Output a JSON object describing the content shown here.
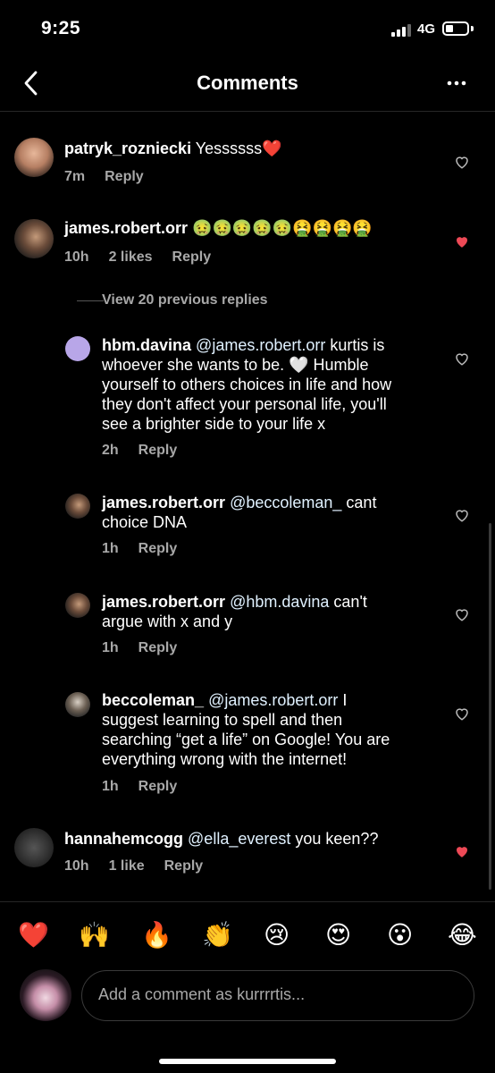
{
  "status": {
    "time": "9:25",
    "network": "4G"
  },
  "header": {
    "title": "Comments"
  },
  "comments": [
    {
      "username": "patryk_rozniecki",
      "text": "Yessssss❤️",
      "time": "7m",
      "likes": "",
      "reply": "Reply",
      "liked": false
    },
    {
      "username": "james.robert.orr",
      "text": "🤢🤢🤢🤢🤢🤮🤮🤮🤮",
      "time": "10h",
      "likes": "2 likes",
      "reply": "Reply",
      "liked": true
    }
  ],
  "view_replies": "View 20 previous replies",
  "replies": [
    {
      "username": "hbm.davina",
      "mention": "@james.robert.orr",
      "text_lines": [
        " kurtis is",
        "whoever she wants to be. 🤍 Humble",
        "yourself to others choices in life and how",
        "they don't affect your personal life, you'll",
        "see a brighter side to your life x"
      ],
      "time": "2h",
      "reply": "Reply"
    },
    {
      "username": "james.robert.orr",
      "mention": "@beccoleman_",
      "text_lines": [
        " cant",
        "choice DNA"
      ],
      "time": "1h",
      "reply": "Reply"
    },
    {
      "username": "james.robert.orr",
      "mention": "@hbm.davina",
      "text_lines": [
        " can't",
        "argue with x and y"
      ],
      "time": "1h",
      "reply": "Reply"
    },
    {
      "username": "beccoleman_",
      "mention": "@james.robert.orr",
      "text_lines": [
        " I",
        "suggest learning to spell and then",
        "searching “get a life” on Google! You are",
        "everything wrong with the internet!"
      ],
      "time": "1h",
      "reply": "Reply"
    }
  ],
  "last_comment": {
    "username": "hannahemcogg",
    "mention": "@ella_everest",
    "text": " you keen??",
    "time": "10h",
    "likes": "1 like",
    "reply": "Reply",
    "liked": true
  },
  "emoji_bar": [
    "❤️",
    "🙌",
    "🔥",
    "👏",
    "😢",
    "😍",
    "😮",
    "😂"
  ],
  "input": {
    "placeholder": "Add a comment as kurrrrtis..."
  },
  "colors": {
    "heart_liked": "#ed4956",
    "meta": "#a8a8a8",
    "mention": "#e0f1ff"
  }
}
